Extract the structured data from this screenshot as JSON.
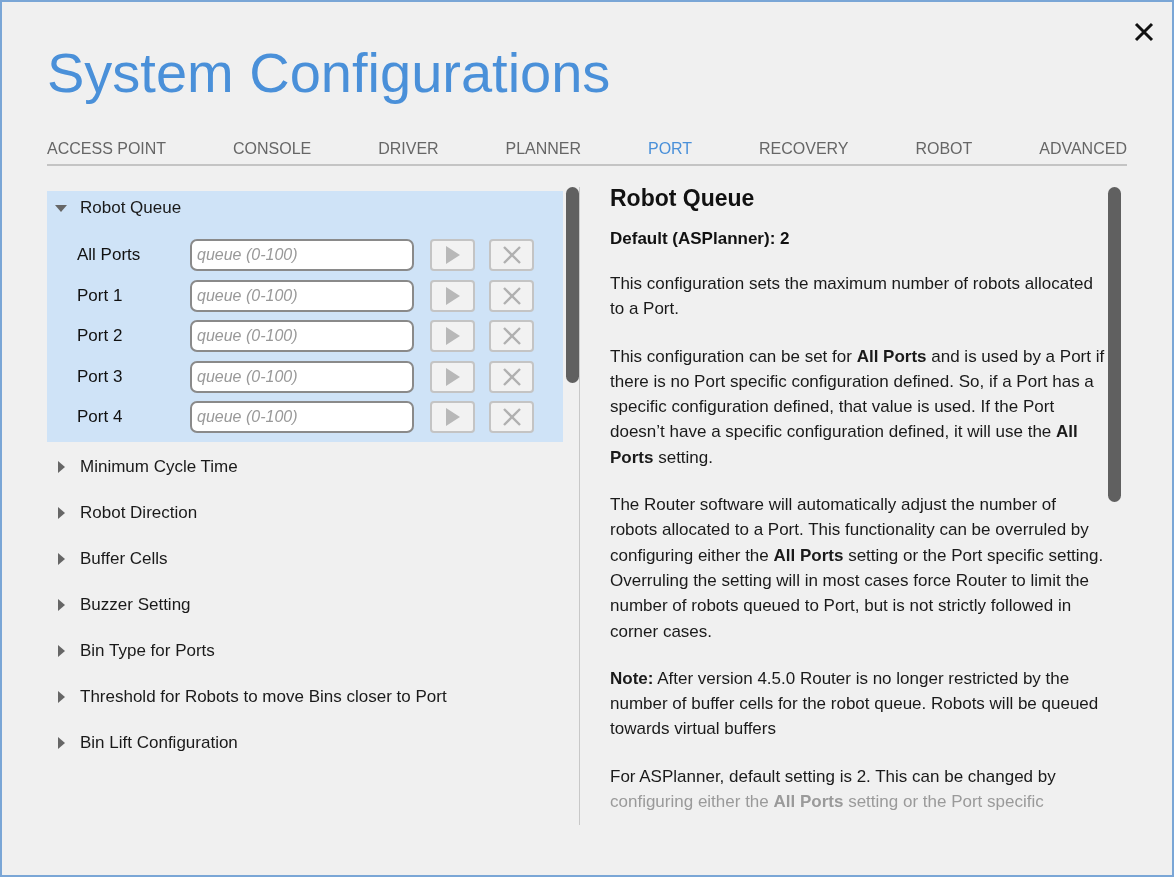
{
  "title": "System Configurations",
  "tabs": [
    {
      "label": "ACCESS POINT",
      "selected": false
    },
    {
      "label": "CONSOLE",
      "selected": false
    },
    {
      "label": "DRIVER",
      "selected": false
    },
    {
      "label": "PLANNER",
      "selected": false
    },
    {
      "label": "PORT",
      "selected": true
    },
    {
      "label": "RECOVERY",
      "selected": false
    },
    {
      "label": "ROBOT",
      "selected": false
    },
    {
      "label": "ADVANCED",
      "selected": false
    }
  ],
  "sections": [
    {
      "title": "Robot Queue",
      "expanded": true,
      "rows": [
        {
          "label": "All Ports",
          "placeholder": "queue (0-100)"
        },
        {
          "label": "Port 1",
          "placeholder": "queue (0-100)"
        },
        {
          "label": "Port 2",
          "placeholder": "queue (0-100)"
        },
        {
          "label": "Port 3",
          "placeholder": "queue (0-100)"
        },
        {
          "label": "Port 4",
          "placeholder": "queue (0-100)"
        }
      ]
    },
    {
      "title": "Minimum Cycle Time",
      "expanded": false
    },
    {
      "title": "Robot Direction",
      "expanded": false
    },
    {
      "title": "Buffer Cells",
      "expanded": false
    },
    {
      "title": "Buzzer Setting",
      "expanded": false
    },
    {
      "title": "Bin Type for Ports",
      "expanded": false
    },
    {
      "title": "Threshold for Robots to move Bins closer to Port",
      "expanded": false
    },
    {
      "title": "Bin Lift Configuration",
      "expanded": false
    }
  ],
  "help": {
    "title": "Robot Queue",
    "default": "Default (ASPlanner): 2",
    "paragraphs": [
      {
        "text": "This configuration sets the maximum number of robots allocated to a Port.",
        "faded": false
      },
      {
        "text": "This configuration can be set for **All Ports** and is used by a Port if there is no Port specific configuration defined. So, if a Port has a specific configuration defined, that value is used. If the Port doesn’t have a specific configuration defined, it will use the **All Ports** setting.",
        "faded": false
      },
      {
        "text": "The Router software will automatically adjust the number of robots allocated to a Port. This functionality can be overruled by configuring either the **All Ports** setting or the Port specific setting. Overruling the setting will in most cases force Router to limit the number of robots queued to Port, but is not strictly followed in corner cases.",
        "faded": false
      },
      {
        "text": "**Note:** After version 4.5.0 Router is no longer restricted by the number of buffer cells for the robot queue. Robots will be queued towards virtual buffers",
        "faded": false
      },
      {
        "text": "For ASPlanner, default setting is 2. This can be changed by",
        "faded": false
      },
      {
        "text": "configuring either the **All Ports** setting or the Port specific",
        "faded": true
      }
    ]
  }
}
